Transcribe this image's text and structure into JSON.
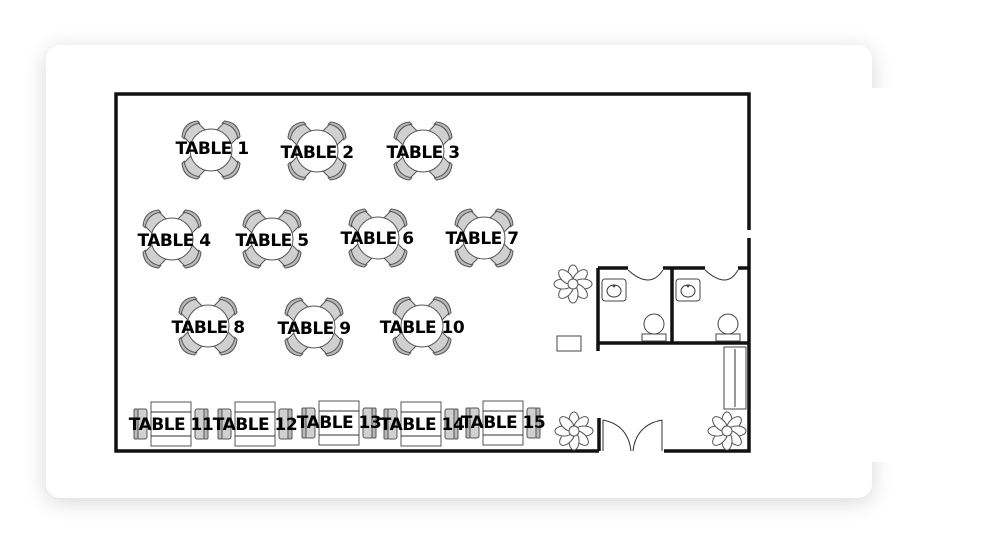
{
  "floor_plan": {
    "round_tables": [
      {
        "label": "TABLE 1"
      },
      {
        "label": "TABLE 2"
      },
      {
        "label": "TABLE 3"
      },
      {
        "label": "TABLE 4"
      },
      {
        "label": "TABLE 5"
      },
      {
        "label": "TABLE 6"
      },
      {
        "label": "TABLE 7"
      },
      {
        "label": "TABLE 8"
      },
      {
        "label": "TABLE 9"
      },
      {
        "label": "TABLE 10"
      }
    ],
    "rect_tables": [
      {
        "label": "TABLE 11"
      },
      {
        "label": "TABLE 12"
      },
      {
        "label": "TABLE 13"
      },
      {
        "label": "TABLE 14"
      },
      {
        "label": "TABLE 15"
      }
    ]
  }
}
